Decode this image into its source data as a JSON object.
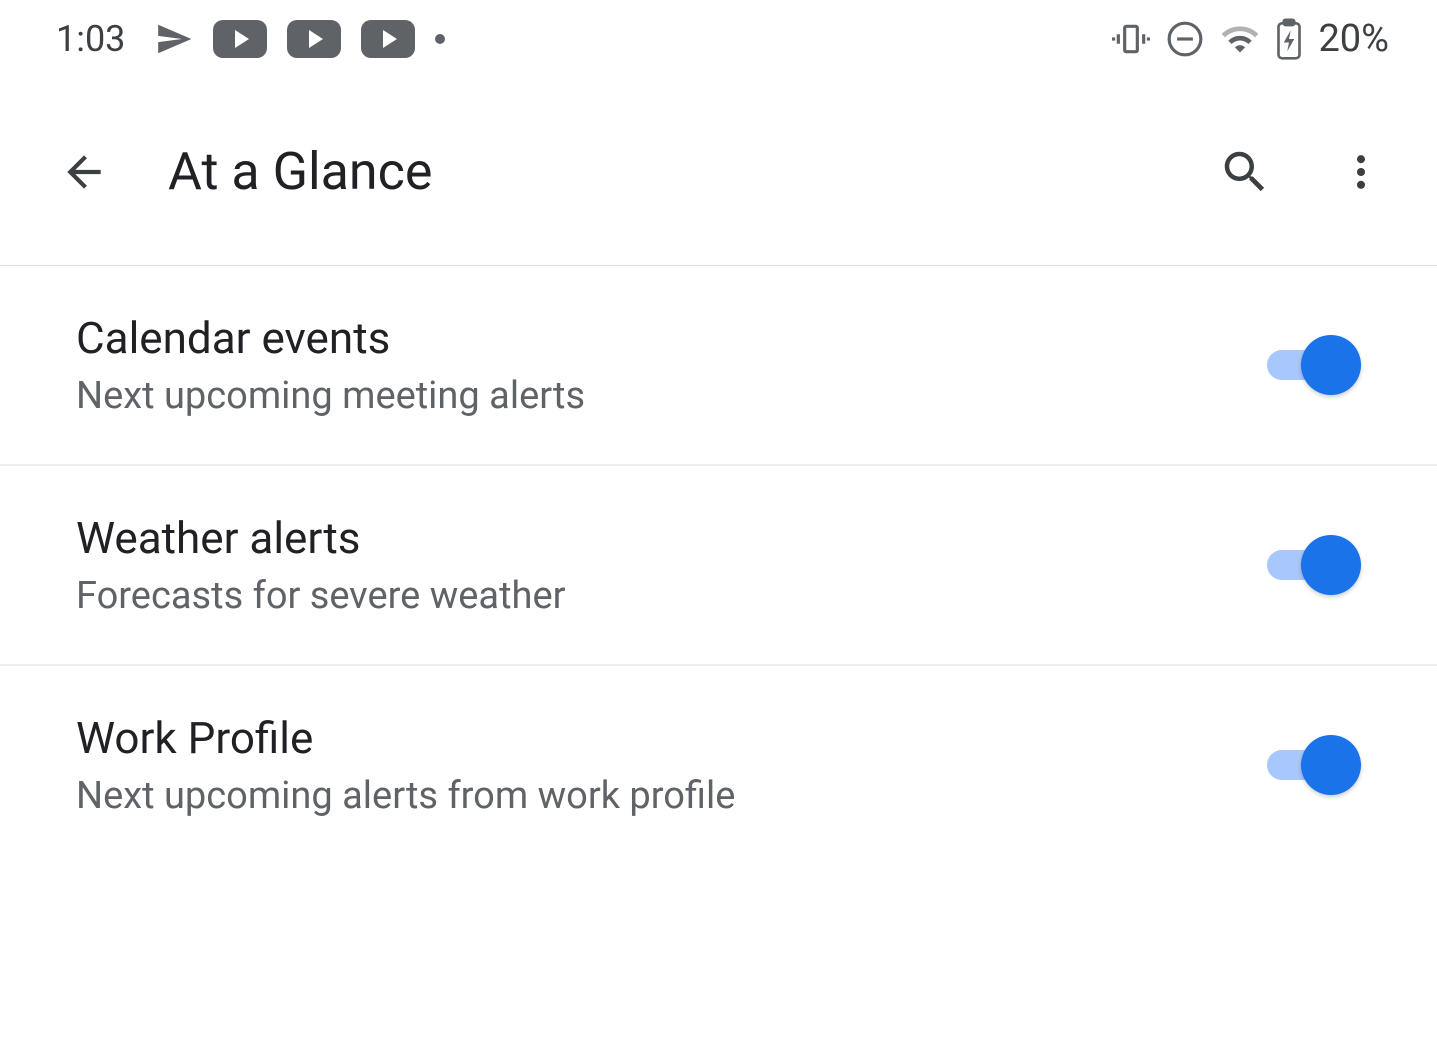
{
  "status_bar": {
    "time": "1:03",
    "battery": "20%"
  },
  "app_bar": {
    "title": "At a Glance"
  },
  "settings": [
    {
      "title": "Calendar events",
      "subtitle": "Next upcoming meeting alerts",
      "enabled": true
    },
    {
      "title": "Weather alerts",
      "subtitle": "Forecasts for severe weather",
      "enabled": true
    },
    {
      "title": "Work Profile",
      "subtitle": "Next upcoming alerts from work profile",
      "enabled": true
    }
  ]
}
